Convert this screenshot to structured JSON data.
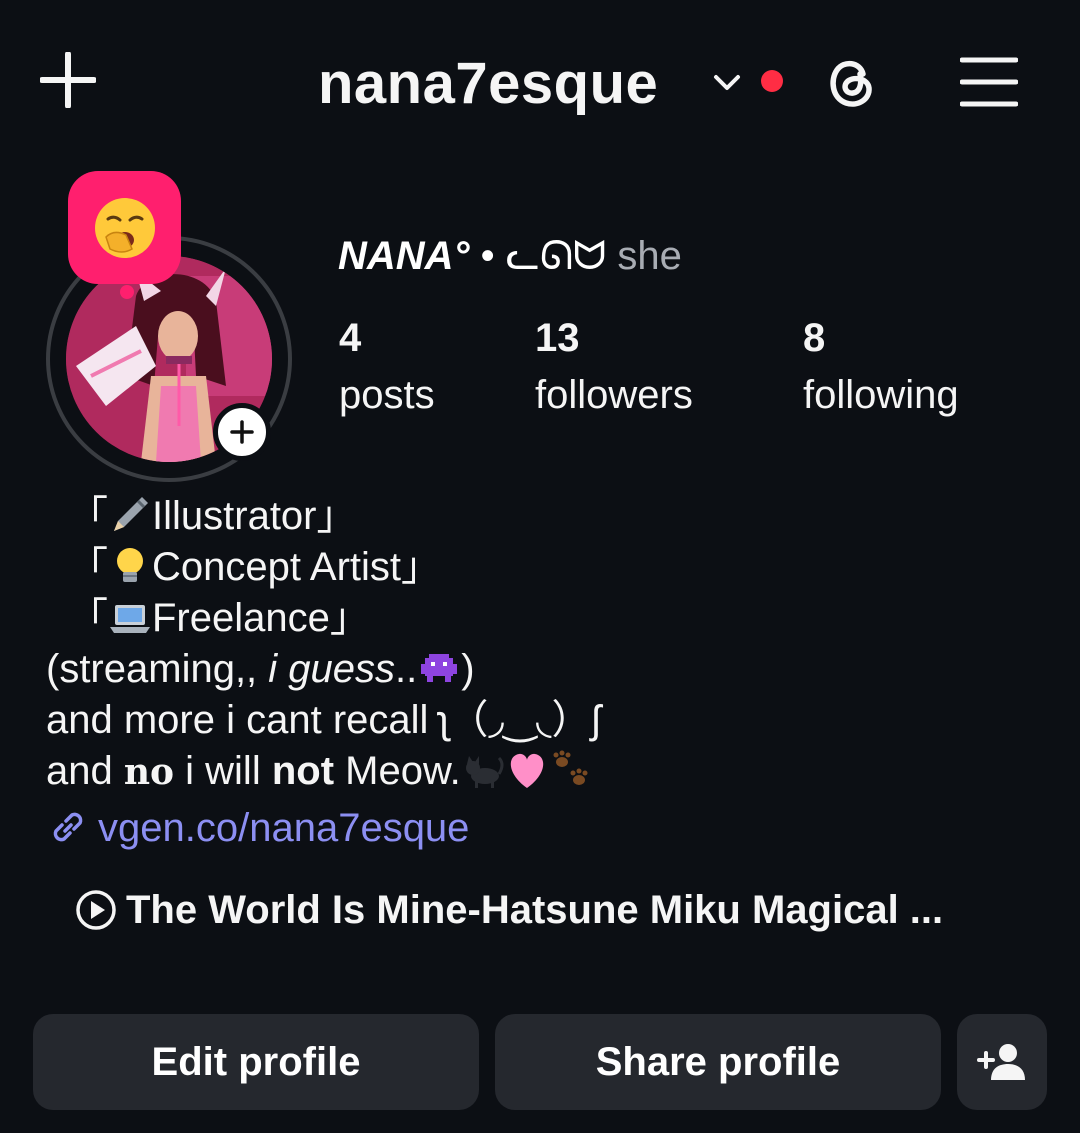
{
  "header": {
    "username": "nana7esque",
    "icons": [
      "plus-icon",
      "chevron-down-icon",
      "notification-dot",
      "threads-icon",
      "menu-icon"
    ],
    "accent_red": "#ff2d44"
  },
  "profile": {
    "display_name": "NANA°",
    "name_separator": " • ",
    "name_decoration": "ᓚᘏᗢ",
    "pronouns": " she",
    "note_emoji": "yawning-face",
    "note_color": "#ff1f6e"
  },
  "stats": {
    "posts": {
      "count": "4",
      "label": "posts"
    },
    "followers": {
      "count": "13",
      "label": "followers"
    },
    "following": {
      "count": "8",
      "label": "following"
    }
  },
  "bio": {
    "line1_open": "「",
    "line1_emoji": "pencil",
    "line1_text": "Illustrator」",
    "line2_open": "「",
    "line2_emoji": "light-bulb",
    "line2_text": "Concept Artist」",
    "line3_open": "「",
    "line3_emoji": "laptop",
    "line3_text": "Freelance」",
    "line4_a": "(streaming,, ",
    "line4_b": "i guess",
    "line4_c": "..",
    "line4_emoji": "alien-monster",
    "line4_d": ")",
    "line5": "and more i cant recall ʅ（◞‿◟）ʃ",
    "line6_a": "and ",
    "line6_b": "no",
    "line6_c": " i will ",
    "line6_d": "not",
    "line6_e": " Meow.",
    "line6_emojis": [
      "black-cat",
      "pink-heart",
      "paw-prints"
    ]
  },
  "link": {
    "text": "vgen.co/nana7esque",
    "color": "#8c8ff2"
  },
  "music": {
    "text": "The World Is Mine-Hatsune Miku Magical ..."
  },
  "buttons": {
    "edit": "Edit profile",
    "share": "Share profile",
    "discover": "add-person-icon",
    "bg": "#25282e"
  }
}
